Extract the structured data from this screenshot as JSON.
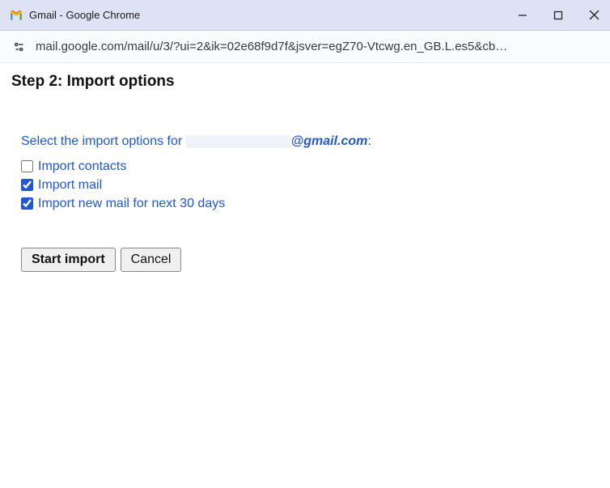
{
  "window": {
    "title": "Gmail - Google Chrome"
  },
  "address": {
    "url": "mail.google.com/mail/u/3/?ui=2&ik=02e68f9d7f&jsver=egZ70-Vtcwg.en_GB.L.es5&cb…"
  },
  "page": {
    "title": "Step 2: Import options",
    "instruction_prefix": "Select the import options for ",
    "email_domain": "@gmail.com",
    "instruction_suffix": ":"
  },
  "options": {
    "contacts": {
      "label": "Import contacts",
      "checked": false
    },
    "mail": {
      "label": "Import mail",
      "checked": true
    },
    "newmail": {
      "label": "Import new mail for next 30 days",
      "checked": true
    }
  },
  "buttons": {
    "start": "Start import",
    "cancel": "Cancel"
  }
}
